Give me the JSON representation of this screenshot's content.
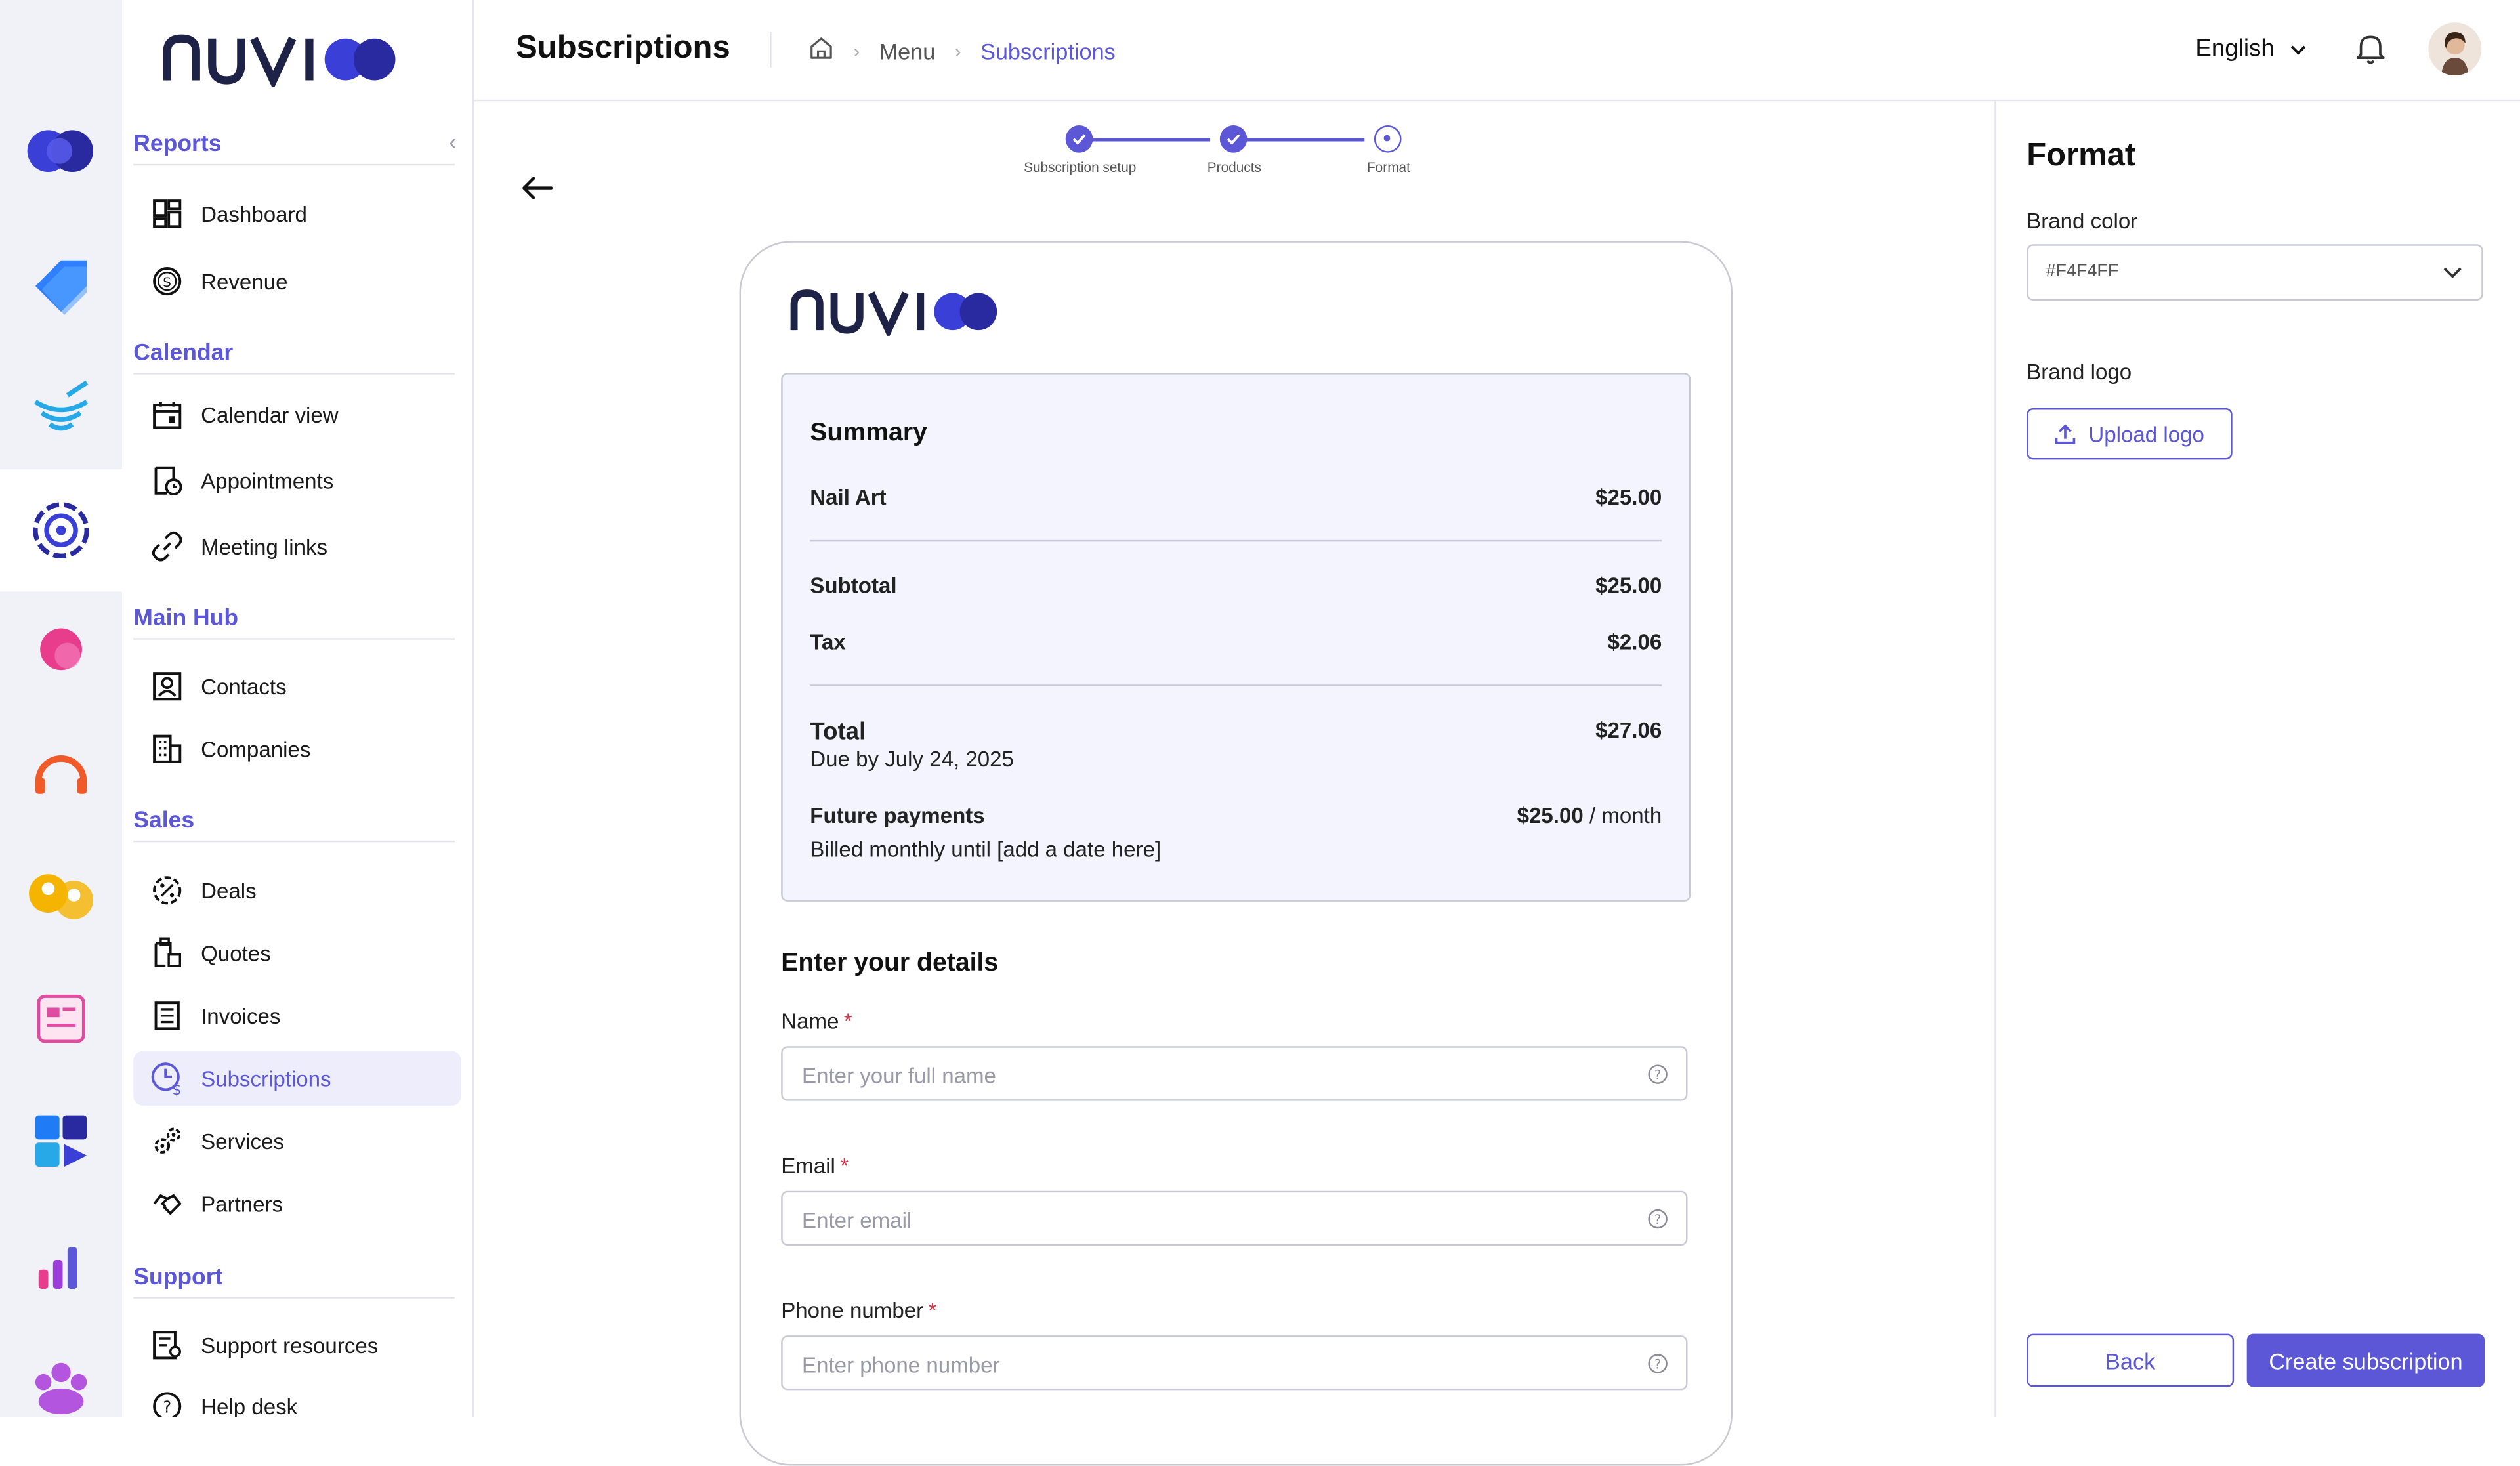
{
  "app": {
    "brand": "nuvi"
  },
  "header": {
    "title": "Subscriptions",
    "breadcrumb": [
      "Menu",
      "Subscriptions"
    ],
    "language": "English"
  },
  "sidebar": {
    "sections": [
      {
        "title": "Reports",
        "items": [
          {
            "label": "Dashboard",
            "icon": "dashboard-icon"
          },
          {
            "label": "Revenue",
            "icon": "dollar-icon"
          }
        ]
      },
      {
        "title": "Calendar",
        "items": [
          {
            "label": "Calendar view",
            "icon": "calendar-icon"
          },
          {
            "label": "Appointments",
            "icon": "appointment-icon"
          },
          {
            "label": "Meeting links",
            "icon": "link-icon"
          }
        ]
      },
      {
        "title": "Main Hub",
        "items": [
          {
            "label": "Contacts",
            "icon": "contact-icon"
          },
          {
            "label": "Companies",
            "icon": "building-icon"
          }
        ]
      },
      {
        "title": "Sales",
        "items": [
          {
            "label": "Deals",
            "icon": "deal-icon"
          },
          {
            "label": "Quotes",
            "icon": "quote-icon"
          },
          {
            "label": "Invoices",
            "icon": "invoice-icon"
          },
          {
            "label": "Subscriptions",
            "icon": "subscription-icon",
            "active": true
          },
          {
            "label": "Services",
            "icon": "services-icon"
          },
          {
            "label": "Partners",
            "icon": "partners-icon"
          }
        ]
      },
      {
        "title": "Support",
        "items": [
          {
            "label": "Support resources",
            "icon": "resources-icon"
          },
          {
            "label": "Help desk",
            "icon": "help-icon"
          }
        ]
      }
    ]
  },
  "stepper": {
    "steps": [
      {
        "label": "Subscription setup",
        "state": "done"
      },
      {
        "label": "Products",
        "state": "done"
      },
      {
        "label": "Format",
        "state": "current"
      }
    ]
  },
  "preview": {
    "summary": {
      "title": "Summary",
      "item": {
        "label": "Nail Art",
        "amount": "$25.00"
      },
      "subtotal": {
        "label": "Subtotal",
        "amount": "$25.00"
      },
      "tax": {
        "label": "Tax",
        "amount": "$2.06"
      },
      "total": {
        "label": "Total",
        "amount": "$27.06",
        "due": "Due by July 24, 2025"
      },
      "future": {
        "label": "Future payments",
        "amount": "$25.00",
        "period": "/ month",
        "note": "Billed monthly until [add a date here]"
      }
    },
    "details": {
      "title": "Enter your details",
      "fields": [
        {
          "label": "Name",
          "placeholder": "Enter your full name"
        },
        {
          "label": "Email",
          "placeholder": "Enter email"
        },
        {
          "label": "Phone number",
          "placeholder": "Enter phone number"
        }
      ],
      "required_mark": "*"
    }
  },
  "panel": {
    "title": "Format",
    "brand_color_label": "Brand color",
    "brand_color_value": "#F4F4FF",
    "brand_logo_label": "Brand logo",
    "upload_label": "Upload logo",
    "back_label": "Back",
    "create_label": "Create subscription"
  },
  "colors": {
    "accent": "#5B57D6",
    "brand_dark": "#1E2247",
    "summary_bg": "#F4F4FF"
  }
}
